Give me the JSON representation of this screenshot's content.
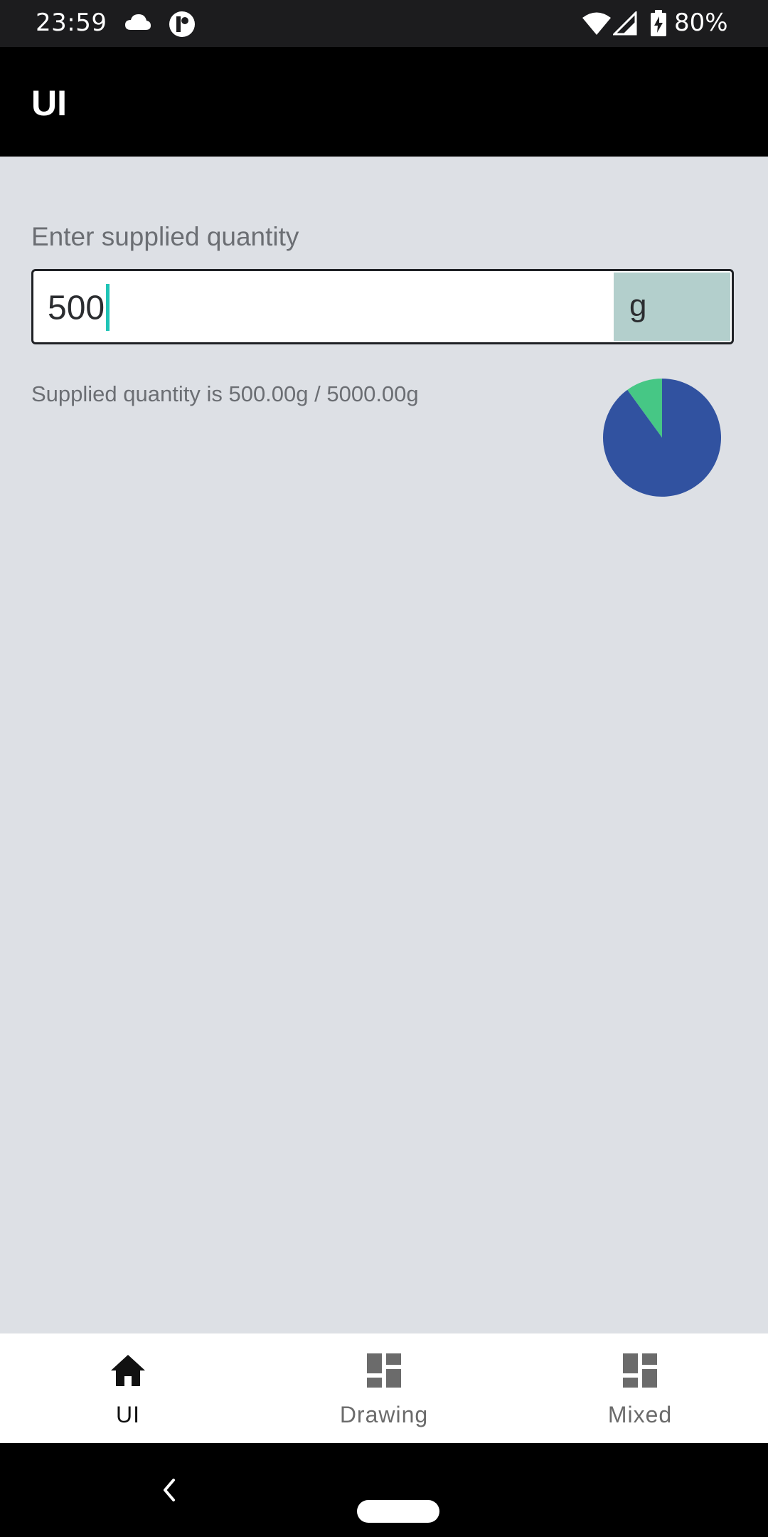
{
  "status_bar": {
    "time": "23:59",
    "battery_percent": "80%",
    "icons": [
      "cloud-icon",
      "app-badge-icon",
      "wifi-icon",
      "signal-icon",
      "battery-charging-icon"
    ]
  },
  "app_bar": {
    "title": "UI"
  },
  "form": {
    "label": "Enter supplied quantity",
    "input_value": "500",
    "unit": "g",
    "supplied_text": "Supplied quantity is 500.00g / 5000.00g"
  },
  "chart_data": {
    "type": "pie",
    "slices": [
      {
        "value": 500,
        "color": "#46c785"
      },
      {
        "value": 4500,
        "color": "#3152a0"
      }
    ]
  },
  "bottom_nav": {
    "items": [
      {
        "label": "UI",
        "icon": "home-icon",
        "active": true
      },
      {
        "label": "Drawing",
        "icon": "dashboard-icon",
        "active": false
      },
      {
        "label": "Mixed",
        "icon": "dashboard-icon",
        "active": false
      }
    ]
  },
  "colors": {
    "background": "#dde0e5",
    "app_bar": "#000000",
    "caret": "#1fc4b6",
    "unit_box": "#b3cfcc",
    "pie_supplied": "#46c785",
    "pie_remaining": "#3152a0"
  }
}
